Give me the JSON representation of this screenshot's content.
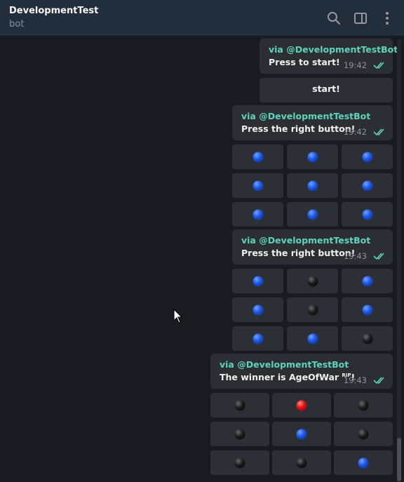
{
  "header": {
    "title": "DevelopmentTest",
    "subtitle": "bot",
    "icons": [
      "search-icon",
      "sidebar-toggle-icon",
      "more-vertical-icon"
    ]
  },
  "messages": [
    {
      "via": "via @DevelopmentTestBot",
      "text": "Press to start!",
      "time": "19:42"
    },
    {
      "via": "via @DevelopmentTestBot",
      "text": "Press the right button!",
      "time": "19:42"
    },
    {
      "via": "via @DevelopmentTestBot",
      "text": "Press the right button!",
      "time": "19:43"
    },
    {
      "via": "via @DevelopmentTestBot",
      "text": "The winner is AgeOfWar",
      "text_sup": "RIP",
      "text_end": "!",
      "time": "19:43"
    }
  ],
  "start_button": {
    "label": "start!"
  },
  "grids": [
    [
      "blue",
      "blue",
      "blue",
      "blue",
      "blue",
      "blue",
      "blue",
      "blue",
      "blue"
    ],
    [
      "blue",
      "black",
      "blue",
      "blue",
      "black",
      "blue",
      "blue",
      "blue",
      "black"
    ],
    [
      "black",
      "red",
      "black",
      "black",
      "blue",
      "black",
      "black",
      "black",
      "blue"
    ]
  ],
  "colors": {
    "accent": "#5fd3bc",
    "bubble": "#2b2f33",
    "background": "#181c20",
    "header": "#232e3c"
  }
}
